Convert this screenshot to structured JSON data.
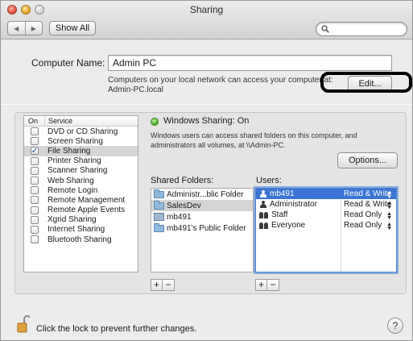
{
  "window": {
    "title": "Sharing"
  },
  "toolbar": {
    "back_icon": "◀",
    "forward_icon": "▶",
    "show_all": "Show All",
    "search_placeholder": ""
  },
  "computer": {
    "label": "Computer Name:",
    "value": "Admin PC",
    "desc_line1": "Computers on your local network can access your computer at:",
    "desc_line2": "Admin-PC.local",
    "edit": "Edit..."
  },
  "services": {
    "col_on": "On",
    "col_service": "Service",
    "items": [
      {
        "label": "DVD or CD Sharing",
        "checked": false
      },
      {
        "label": "Screen Sharing",
        "checked": false
      },
      {
        "label": "File Sharing",
        "checked": true,
        "selected": true
      },
      {
        "label": "Printer Sharing",
        "checked": false
      },
      {
        "label": "Scanner Sharing",
        "checked": false
      },
      {
        "label": "Web Sharing",
        "checked": false
      },
      {
        "label": "Remote Login",
        "checked": false
      },
      {
        "label": "Remote Management",
        "checked": false
      },
      {
        "label": "Remote Apple Events",
        "checked": false
      },
      {
        "label": "Xgrid Sharing",
        "checked": false
      },
      {
        "label": "Internet Sharing",
        "checked": false
      },
      {
        "label": "Bluetooth Sharing",
        "checked": false
      }
    ]
  },
  "status": {
    "text": "Windows Sharing: On",
    "desc_line1": "Windows users can access shared folders on this computer, and",
    "desc_line2": "administrators all volumes, at \\\\Admin-PC.",
    "options": "Options...",
    "color": "#4bb22b"
  },
  "shared_folders": {
    "label": "Shared Folders:",
    "items": [
      {
        "label": "Administr...blic Folder",
        "icon": "folder-icon"
      },
      {
        "label": "SalesDev",
        "icon": "folder-icon",
        "selected": true
      },
      {
        "label": "mb491",
        "icon": "user-folder-icon"
      },
      {
        "label": "mb491's Public Folder",
        "icon": "folder-icon"
      }
    ]
  },
  "users": {
    "label": "Users:",
    "items": [
      {
        "name": "mb491",
        "permission": "Read & Write",
        "icon": "person-icon",
        "selected": true
      },
      {
        "name": "Administrator",
        "permission": "Read & Write",
        "icon": "person-icon"
      },
      {
        "name": "Staff",
        "permission": "Read Only",
        "icon": "group-icon"
      },
      {
        "name": "Everyone",
        "permission": "Read Only",
        "icon": "group-icon"
      }
    ]
  },
  "buttons": {
    "add": "+",
    "remove": "−"
  },
  "footer": {
    "lock_text": "Click the lock to prevent further changes.",
    "help": "?"
  },
  "colors": {
    "selection": "#3b74d3",
    "status_on": "#4bb22b"
  }
}
